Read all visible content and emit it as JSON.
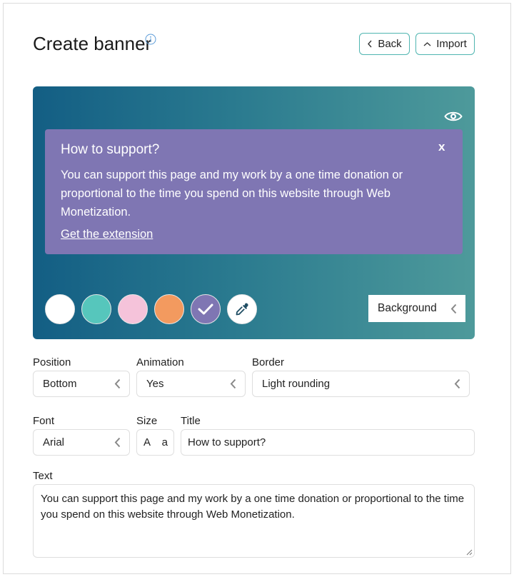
{
  "header": {
    "title": "Create banner",
    "back_label": "Back",
    "import_label": "Import"
  },
  "preview": {
    "banner_title": "How to support?",
    "close_label": "x",
    "banner_text": "You can support this page and my work by a one time donation or proportional to the time you spend on this website through Web Monetization.",
    "link_text": "Get the extension",
    "background_select": "Background",
    "swatches": [
      {
        "name": "white",
        "color": "#ffffff"
      },
      {
        "name": "teal",
        "color": "#56c6bc"
      },
      {
        "name": "pink",
        "color": "#f5c3da"
      },
      {
        "name": "orange",
        "color": "#f39a5f"
      },
      {
        "name": "purple",
        "color": "#7f76b3",
        "selected": true
      },
      {
        "name": "eyedropper",
        "color": "#ffffff"
      }
    ]
  },
  "form": {
    "position": {
      "label": "Position",
      "value": "Bottom"
    },
    "animation": {
      "label": "Animation",
      "value": "Yes"
    },
    "border": {
      "label": "Border",
      "value": "Light rounding"
    },
    "font": {
      "label": "Font",
      "value": "Arial"
    },
    "size": {
      "label": "Size",
      "larger": "A",
      "smaller": "a"
    },
    "title": {
      "label": "Title",
      "value": "How to support?"
    },
    "text": {
      "label": "Text",
      "value": "You can support this page and my work by a one time donation or proportional to the time you spend on this website through Web Monetization."
    }
  },
  "colors": {
    "accent_border": "#4fb5b0",
    "gradient_start": "#135e84",
    "gradient_end": "#4e9a9b",
    "card_bg": "#7f76b3"
  }
}
